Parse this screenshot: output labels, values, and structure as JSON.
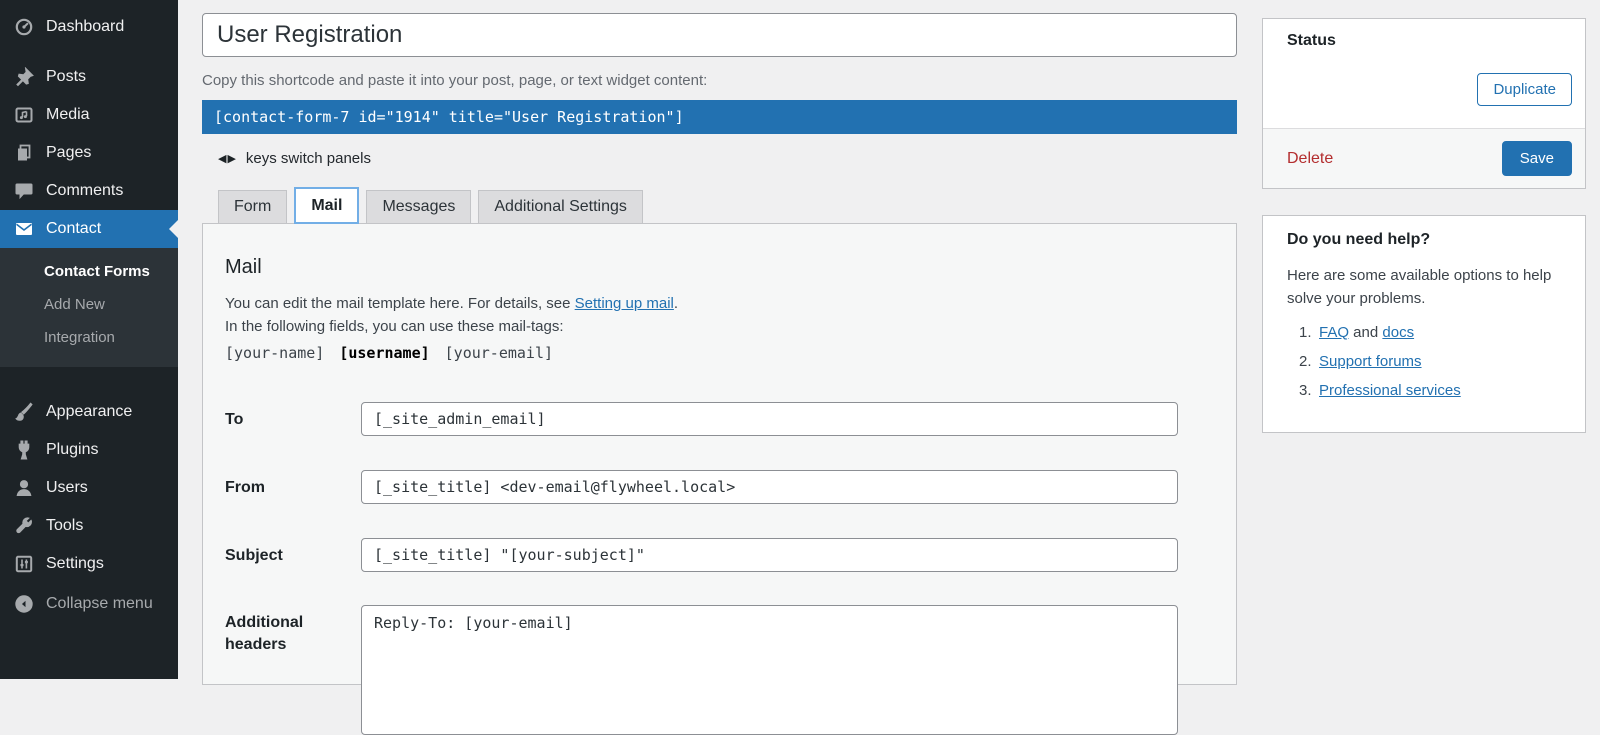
{
  "colors": {
    "accent_blue": "#2271b1",
    "sidebar_bg": "#1d2327",
    "submenu_bg": "#2c3338",
    "page_bg": "#f0f0f1",
    "danger_red": "#b32d2e",
    "active_tab_border": "#72aee6"
  },
  "sidebar": {
    "items_top": [
      {
        "label": "Dashboard"
      },
      {
        "label": "Posts"
      },
      {
        "label": "Media"
      },
      {
        "label": "Pages"
      },
      {
        "label": "Comments"
      },
      {
        "label": "Contact"
      }
    ],
    "submenu": [
      {
        "label": "Contact Forms"
      },
      {
        "label": "Add New"
      },
      {
        "label": "Integration"
      }
    ],
    "items_bottom": [
      {
        "label": "Appearance"
      },
      {
        "label": "Plugins"
      },
      {
        "label": "Users"
      },
      {
        "label": "Tools"
      },
      {
        "label": "Settings"
      }
    ],
    "collapse_label": "Collapse menu"
  },
  "header": {
    "title_value": "User Registration",
    "shortcode_hint": "Copy this shortcode and paste it into your post, page, or text widget content:",
    "shortcode": "[contact-form-7 id=\"1914\" title=\"User Registration\"]",
    "keys_arrows": "◀▶",
    "keys_hint": "keys switch panels"
  },
  "tabs": [
    {
      "label": "Form"
    },
    {
      "label": "Mail",
      "active": true
    },
    {
      "label": "Messages"
    },
    {
      "label": "Additional Settings"
    }
  ],
  "mail_panel": {
    "heading": "Mail",
    "desc_pre": "You can edit the mail template here. For details, see ",
    "desc_link": "Setting up mail",
    "desc_post": ".",
    "desc_line2": "In the following fields, you can use these mail-tags:",
    "tags": [
      "[your-name]",
      "[username]",
      "[your-email]"
    ],
    "fields": [
      {
        "label": "To",
        "value": "[_site_admin_email]"
      },
      {
        "label": "From",
        "value": "[_site_title] <dev-email@flywheel.local>"
      },
      {
        "label": "Subject",
        "value": "[_site_title] \"[your-subject]\""
      },
      {
        "label": "Additional headers",
        "value": "Reply-To: [your-email]"
      }
    ]
  },
  "status_box": {
    "title": "Status",
    "duplicate_label": "Duplicate",
    "delete_label": "Delete",
    "save_label": "Save"
  },
  "help_box": {
    "title": "Do you need help?",
    "intro": "Here are some available options to help solve your problems.",
    "markers": [
      "1.",
      "2.",
      "3."
    ],
    "item1_link1": "FAQ",
    "item1_mid": " and ",
    "item1_link2": "docs",
    "item2_link": "Support forums",
    "item3_link": "Professional services"
  }
}
